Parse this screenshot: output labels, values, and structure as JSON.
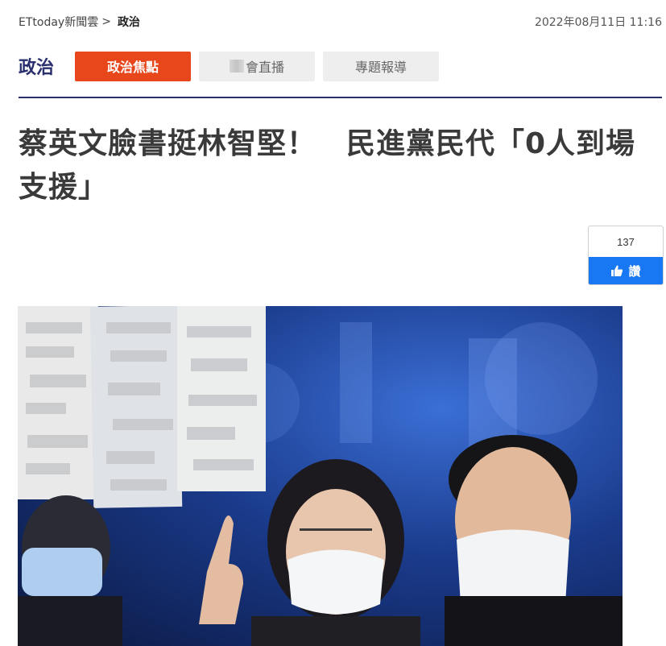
{
  "breadcrumb": {
    "home": "ETtoday新聞雲",
    "separator": ">",
    "current": "政治"
  },
  "datetime": "2022年08月11日 11:16",
  "section": {
    "title": "政治",
    "tabs": [
      {
        "label": "政治焦點",
        "active": true
      },
      {
        "label": "會直播",
        "active": false
      },
      {
        "label": "專題報導",
        "active": false
      }
    ]
  },
  "article": {
    "headline": "蔡英文臉書挺林智堅！　民進黨民代「0人到場支援」"
  },
  "like": {
    "count": "137",
    "label": "讚",
    "icon": "thumbs-up-icon"
  },
  "colors": {
    "accent": "#e8471c",
    "section_title": "#2a2f6e",
    "facebook_blue": "#1877f2"
  }
}
